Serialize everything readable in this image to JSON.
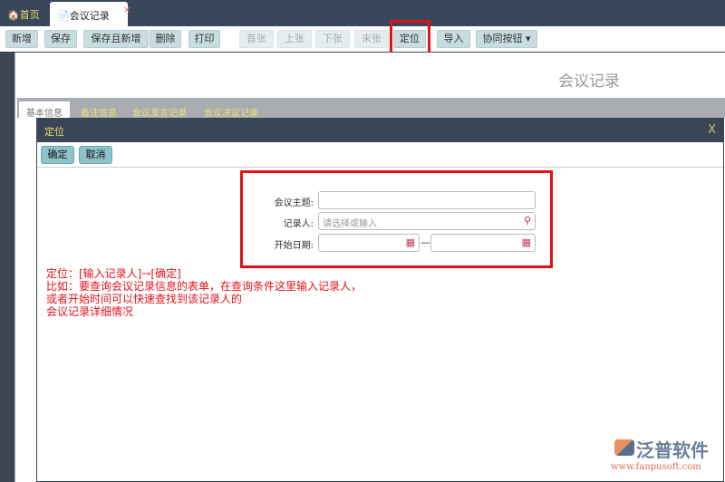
{
  "tabs": {
    "home": "首页",
    "active": "会议记录",
    "close": "×"
  },
  "toolbar": [
    "新增",
    "保存",
    "保存且新增",
    "删除",
    "打印",
    "首张",
    "上张",
    "下张",
    "末张",
    "定位",
    "导入",
    "协同按钮 ▾"
  ],
  "page_title": "会议记录",
  "subtabs": [
    "基本信息",
    "备注信息",
    "会议发言记录",
    "会议决议记录"
  ],
  "dialog": {
    "title": "定位",
    "close": "X",
    "ok": "确定",
    "cancel": "取消",
    "fields": {
      "topic_label": "会议主题:",
      "recorder_label": "记录人:",
      "recorder_placeholder": "请选择或输入",
      "date_label": "开始日期:",
      "dash": "—"
    }
  },
  "note": [
    "定位：[输入记录人]→[确定]",
    "比如：要查询会议记录信息的表单，在查询条件这里输入记录人，",
    "或者开始时间可以快速查找到该记录人的",
    "会议记录详细情况"
  ],
  "logo": {
    "name": "泛普软件",
    "url": "www.fanpusoft.com"
  }
}
